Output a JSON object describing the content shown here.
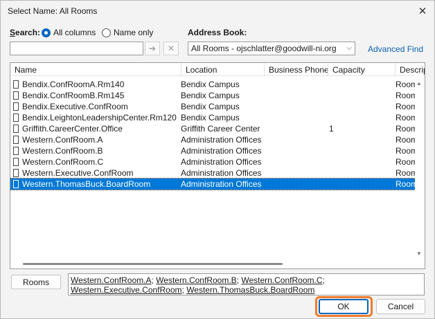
{
  "window": {
    "title": "Select Name: All Rooms",
    "close_icon": "close-icon"
  },
  "search": {
    "label": "Search:",
    "option_all_columns": "All columns",
    "option_name_only": "Name only",
    "selected_option": "All columns",
    "value": "",
    "go_icon": "arrow-right-icon",
    "clear_icon": "clear-x-icon"
  },
  "address_book": {
    "label": "Address Book:",
    "selected": "All Rooms - ojschlatter@goodwill-ni.org",
    "dropdown_icon": "chevron-down-icon",
    "advanced_find": "Advanced Find"
  },
  "table": {
    "columns": [
      "Name",
      "Location",
      "Business Phone",
      "Capacity",
      "Descrip"
    ],
    "rows": [
      {
        "name": "Bendix.ConfRoomA.Rm140",
        "location": "Bendix Campus",
        "phone": "",
        "capacity": "",
        "description": "Room",
        "selected": false
      },
      {
        "name": "Bendix.ConfRoomB.Rm145",
        "location": "Bendix Campus",
        "phone": "",
        "capacity": "",
        "description": "Room",
        "selected": false
      },
      {
        "name": "Bendix.Executive.ConfRoom",
        "location": "Bendix Campus",
        "phone": "",
        "capacity": "",
        "description": "Room",
        "selected": false
      },
      {
        "name": "Bendix.LeightonLeadershipCenter.Rm120",
        "location": "Bendix Campus",
        "phone": "",
        "capacity": "",
        "description": "Room",
        "selected": false
      },
      {
        "name": "Griffith.CareerCenter.Office",
        "location": "Griffith Career Center",
        "phone": "",
        "capacity": "1",
        "description": "Room",
        "selected": false
      },
      {
        "name": "Western.ConfRoom.A",
        "location": "Administration Offices",
        "phone": "",
        "capacity": "",
        "description": "Room",
        "selected": false
      },
      {
        "name": "Western.ConfRoom.B",
        "location": "Administration Offices",
        "phone": "",
        "capacity": "",
        "description": "Room",
        "selected": false
      },
      {
        "name": "Western.ConfRoom.C",
        "location": "Administration Offices",
        "phone": "",
        "capacity": "",
        "description": "Room",
        "selected": false
      },
      {
        "name": "Western.Executive.ConfRoom",
        "location": "Administration Offices",
        "phone": "",
        "capacity": "",
        "description": "Room",
        "selected": false
      },
      {
        "name": "Western.ThomasBuck.BoardRoom",
        "location": "Administration Offices",
        "phone": "",
        "capacity": "",
        "description": "Room",
        "selected": true
      }
    ]
  },
  "rooms": {
    "button_label": "Rooms",
    "selected_items": [
      "Western.ConfRoom.A",
      "Western.ConfRoom.B",
      "Western.ConfRoom.C",
      "Western.Executive.ConfRoom",
      "Western.ThomasBuck.BoardRoom"
    ]
  },
  "buttons": {
    "ok": "OK",
    "cancel": "Cancel"
  },
  "colors": {
    "selection": "#0078d7",
    "link": "#0a62b5",
    "highlight_ring": "#f07c2c"
  }
}
